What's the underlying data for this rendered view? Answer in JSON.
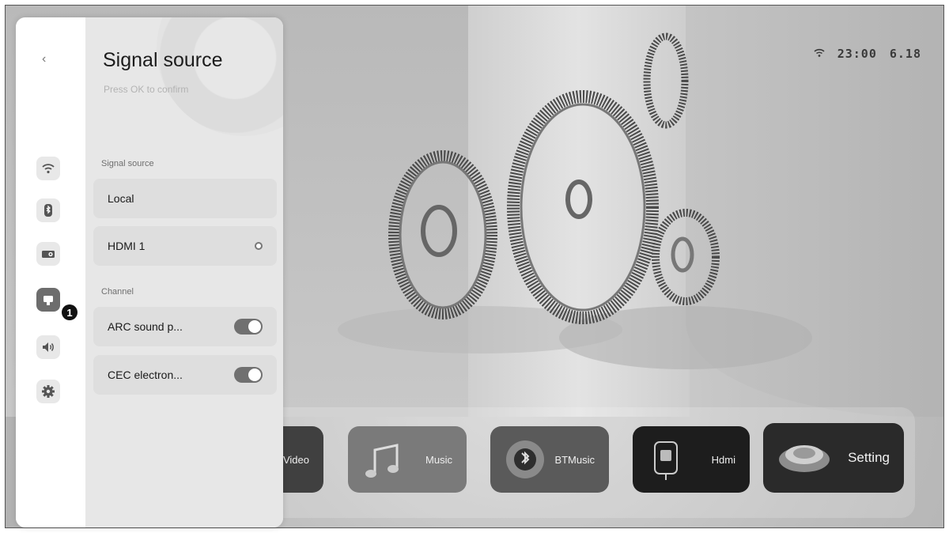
{
  "status_bar": {
    "time": "23:00",
    "date": "6.18",
    "wifi_icon": "wifi-icon"
  },
  "panel": {
    "back_icon": "‹",
    "title": "Signal source",
    "subtitle": "Press OK to confirm",
    "sections": [
      {
        "label": "Signal source"
      },
      {
        "label": "Channel"
      }
    ],
    "options": [
      {
        "label": "Local",
        "control": "none"
      },
      {
        "label": "HDMI 1",
        "control": "radio"
      },
      {
        "label": "ARC sound p...",
        "control": "toggle",
        "on": true
      },
      {
        "label": "CEC electron...",
        "control": "toggle",
        "on": true
      }
    ],
    "rail_icons": [
      "wifi-icon",
      "bluetooth-icon",
      "projector-icon",
      "hdmi-icon",
      "volume-icon",
      "gear-icon"
    ],
    "badge": "1"
  },
  "apps": [
    {
      "label": "Video"
    },
    {
      "label": "Music"
    },
    {
      "label": "BTMusic"
    },
    {
      "label": "Hdmi"
    },
    {
      "label": "Setting"
    }
  ]
}
